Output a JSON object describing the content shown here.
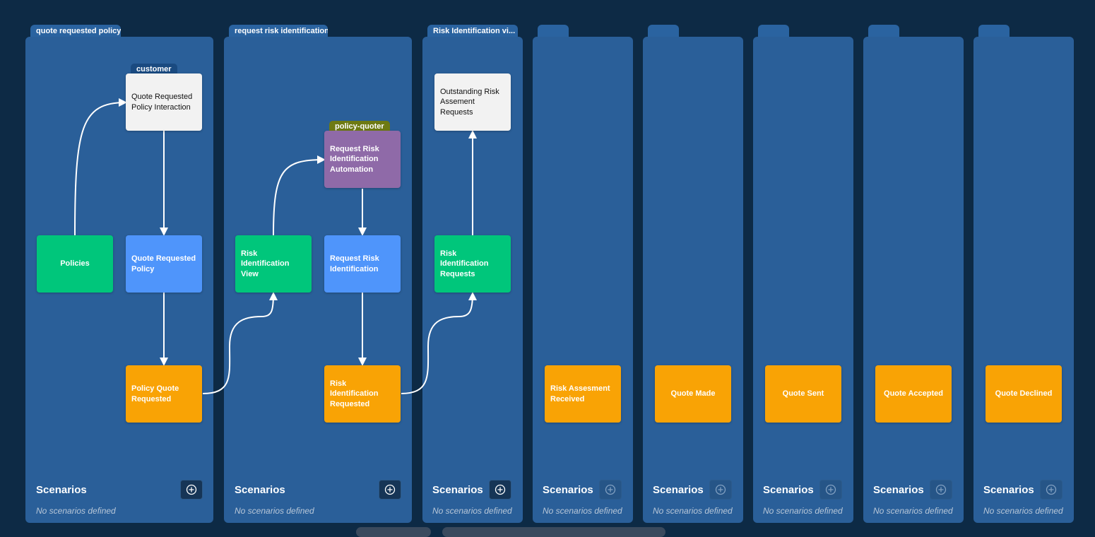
{
  "columns": [
    {
      "tab": "quote requested policy"
    },
    {
      "tab": "request risk identification"
    },
    {
      "tab": "Risk Identification vi..."
    },
    {
      "tab": ""
    },
    {
      "tab": ""
    },
    {
      "tab": ""
    },
    {
      "tab": ""
    },
    {
      "tab": ""
    }
  ],
  "roles": {
    "customer": "customer",
    "policy_quoter": "policy-quoter"
  },
  "cards": {
    "quote_requested_policy_interaction": "Quote Requested Policy Interaction",
    "policies": "Policies",
    "quote_requested_policy": "Quote Requested Policy",
    "policy_quote_requested": "Policy Quote Requested",
    "risk_identification_view": "Risk Identification View",
    "request_risk_identification_automation": "Request Risk Identification Automation",
    "request_risk_identification": "Request Risk Identification",
    "risk_identification_requested": "Risk Identification Requested",
    "outstanding_risk_assesment_requests": "Outstanding Risk Assement Requests",
    "risk_identification_requests": "Risk Identification Requests",
    "risk_assesment_received": "Risk Assesment Received",
    "quote_made": "Quote Made",
    "quote_sent": "Quote Sent",
    "quote_accepted": "Quote Accepted",
    "quote_declined": "Quote Declined"
  },
  "scenarios": {
    "title": "Scenarios",
    "empty": "No scenarios defined"
  },
  "colors": {
    "background": "#0d2a45",
    "column": "#2a5f99",
    "event": "#f9a305",
    "command": "#4f95fb",
    "read_model": "#00c67b",
    "automation": "#8f6aa8",
    "screen": "#f2f2f2"
  }
}
